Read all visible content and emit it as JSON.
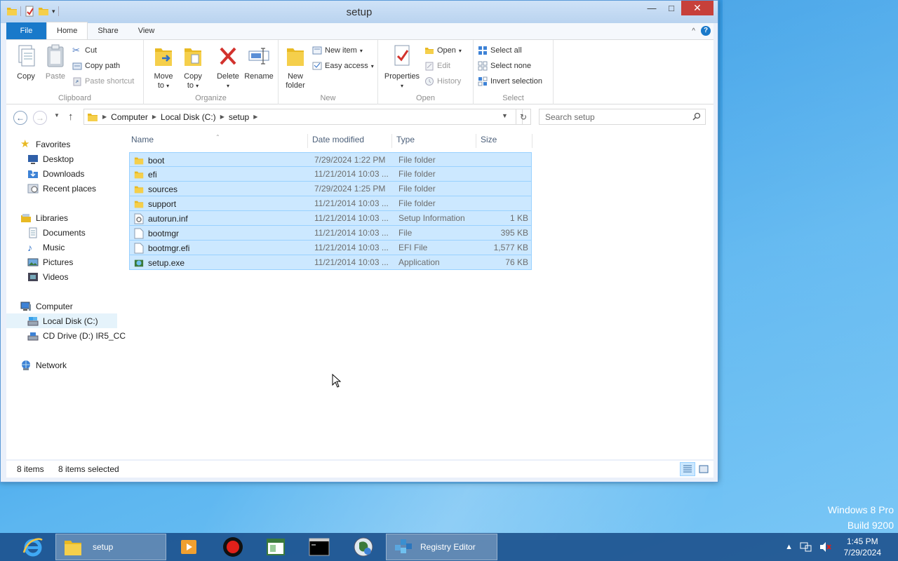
{
  "window": {
    "title": "setup",
    "tabs": [
      "File",
      "Home",
      "Share",
      "View"
    ]
  },
  "ribbon": {
    "clipboard": {
      "label": "Clipboard",
      "copy": "Copy",
      "paste": "Paste",
      "cut": "Cut",
      "copy_path": "Copy path",
      "paste_shortcut": "Paste shortcut"
    },
    "organize": {
      "label": "Organize",
      "move_to": "Move",
      "move_to_2": "to",
      "copy_to": "Copy",
      "copy_to_2": "to",
      "delete": "Delete",
      "rename": "Rename"
    },
    "new": {
      "label": "New",
      "new_folder": "New",
      "new_folder_2": "folder",
      "new_item": "New item",
      "easy_access": "Easy access"
    },
    "open": {
      "label": "Open",
      "properties": "Properties",
      "open": "Open",
      "edit": "Edit",
      "history": "History"
    },
    "select": {
      "label": "Select",
      "select_all": "Select all",
      "select_none": "Select none",
      "invert_selection": "Invert selection"
    }
  },
  "address": {
    "crumbs": [
      "Computer",
      "Local Disk (C:)",
      "setup"
    ],
    "search_placeholder": "Search setup"
  },
  "navpane": {
    "favorites": "Favorites",
    "desktop": "Desktop",
    "downloads": "Downloads",
    "recent": "Recent places",
    "libraries": "Libraries",
    "documents": "Documents",
    "music": "Music",
    "pictures": "Pictures",
    "videos": "Videos",
    "computer": "Computer",
    "local_disk": "Local Disk (C:)",
    "cd_drive": "CD Drive (D:) IR5_CC",
    "network": "Network"
  },
  "columns": {
    "name": "Name",
    "date": "Date modified",
    "type": "Type",
    "size": "Size"
  },
  "files": [
    {
      "name": "boot",
      "date": "7/29/2024 1:22 PM",
      "type": "File folder",
      "size": "",
      "icon": "folder-icon"
    },
    {
      "name": "efi",
      "date": "11/21/2014 10:03 ...",
      "type": "File folder",
      "size": "",
      "icon": "folder-icon"
    },
    {
      "name": "sources",
      "date": "7/29/2024 1:25 PM",
      "type": "File folder",
      "size": "",
      "icon": "folder-icon"
    },
    {
      "name": "support",
      "date": "11/21/2014 10:03 ...",
      "type": "File folder",
      "size": "",
      "icon": "folder-icon"
    },
    {
      "name": "autorun.inf",
      "date": "11/21/2014 10:03 ...",
      "type": "Setup Information",
      "size": "1 KB",
      "icon": "settings-file-icon"
    },
    {
      "name": "bootmgr",
      "date": "11/21/2014 10:03 ...",
      "type": "File",
      "size": "395 KB",
      "icon": "file-icon"
    },
    {
      "name": "bootmgr.efi",
      "date": "11/21/2014 10:03 ...",
      "type": "EFI File",
      "size": "1,577 KB",
      "icon": "file-icon"
    },
    {
      "name": "setup.exe",
      "date": "11/21/2014 10:03 ...",
      "type": "Application",
      "size": "76 KB",
      "icon": "setup-exe-icon"
    }
  ],
  "status": {
    "count": "8 items",
    "selected": "8 items selected"
  },
  "watermark": {
    "line1": "Windows 8 Pro",
    "line2": "Build 9200"
  },
  "taskbar": {
    "explorer_label": "setup",
    "regedit_label": "Registry Editor",
    "time": "1:45 PM",
    "date": "7/29/2024"
  }
}
